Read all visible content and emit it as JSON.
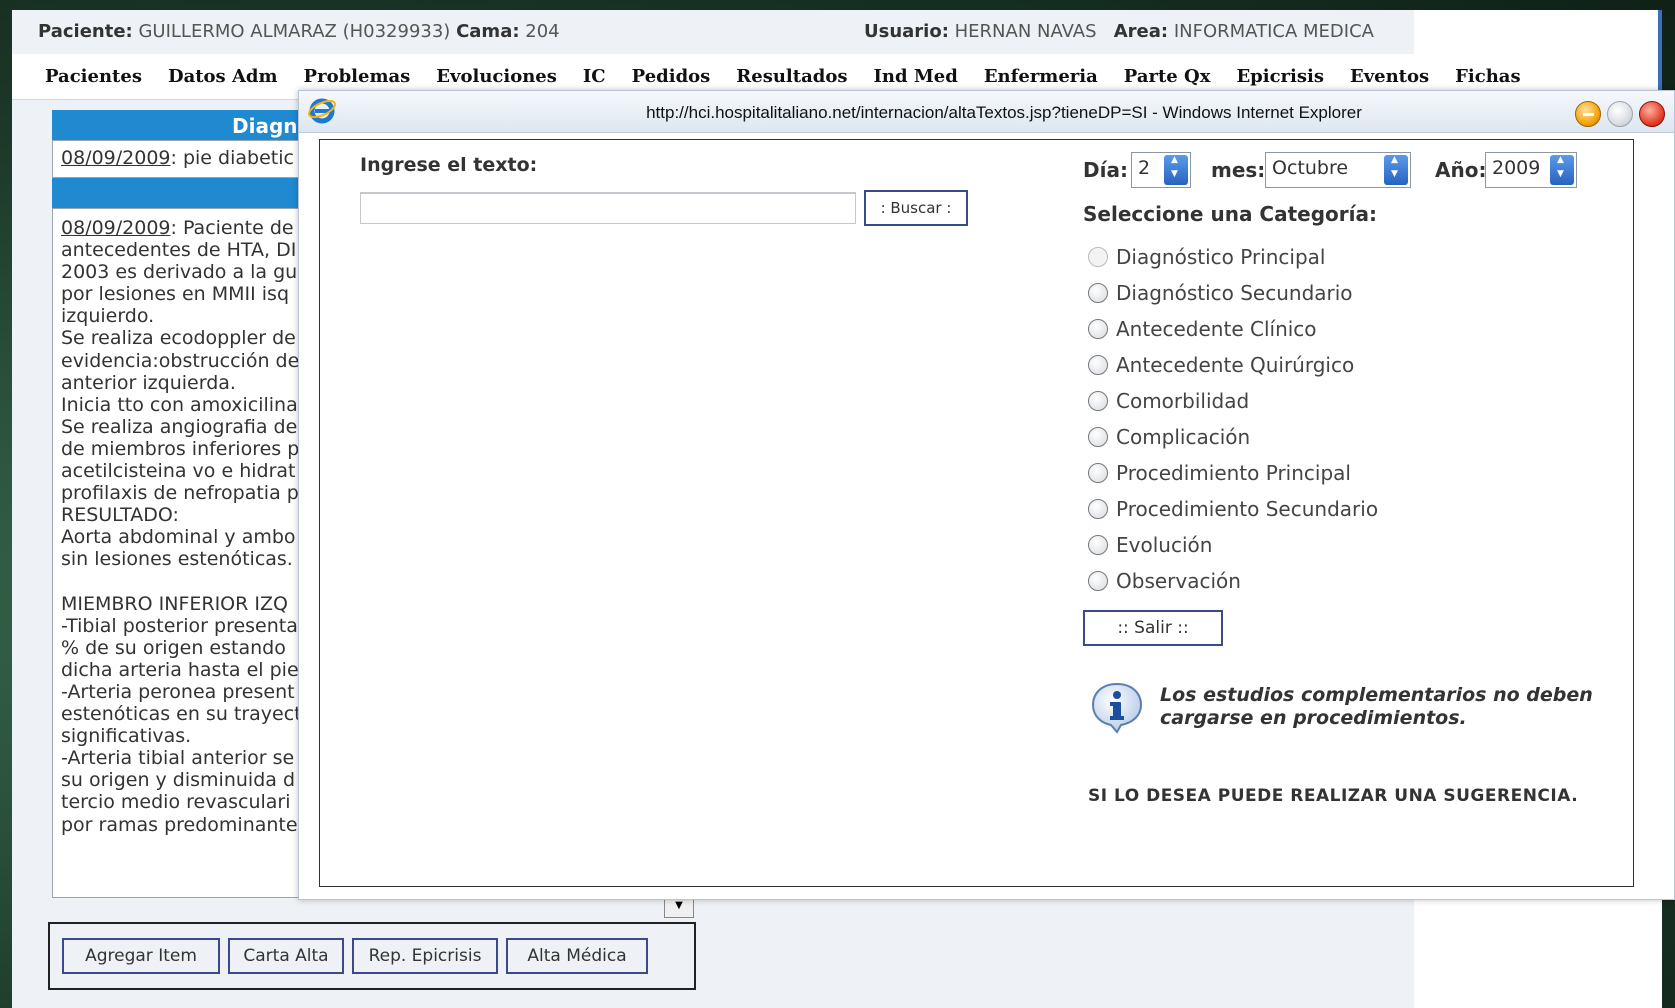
{
  "patient_bar": {
    "paciente_label": "Paciente:",
    "paciente_value": "GUILLERMO ALMARAZ  (H0329933)",
    "cama_label": "Cama:",
    "cama_value": "204",
    "usuario_label": "Usuario:",
    "usuario_value": "HERNAN NAVAS",
    "area_label": "Area:",
    "area_value": "INFORMATICA MEDICA"
  },
  "nav": {
    "items": [
      "Pacientes",
      "Datos Adm",
      "Problemas",
      "Evoluciones",
      "IC",
      "Pedidos",
      "Resultados",
      "Ind Med",
      "Enfermeria",
      "Parte Qx",
      "Epicrisis",
      "Eventos",
      "Fichas"
    ]
  },
  "left_panel": {
    "diag_header": "Diagno",
    "diag_date": "08/09/2009",
    "diag_text": ": pie diabetic",
    "notes_date": "08/09/2009",
    "notes_first": ": Paciente de",
    "notes_lines": [
      "antecedentes de HTA, DI",
      "2003 es derivado a la gu",
      "por lesiones en MMII isq",
      "izquierdo.",
      "Se realiza ecodoppler de",
      "evidencia:obstrucción de",
      "anterior izquierda.",
      "Inicia tto con amoxicilina",
      "Se realiza angiografia de",
      "de miembros inferiores p",
      "acetilcisteina vo e hidrat",
      "profilaxis de nefropatia p",
      "RESULTADO:",
      "Aorta abdominal y ambo",
      "sin lesiones estenóticas.",
      "",
      "MIEMBRO INFERIOR IZQ",
      "-Tibial posterior presenta",
      "% de su origen estando",
      "dicha arteria hasta el pie",
      "-Arteria peronea present",
      "estenóticas en su trayect",
      "significativas.",
      "-Arteria tibial anterior se",
      "su origen y disminuida d",
      "tercio medio revasculari",
      "por ramas predominante"
    ],
    "buttons": [
      "Agregar Item",
      "Carta Alta",
      "Rep. Epicrisis",
      "Alta Médica"
    ]
  },
  "popup": {
    "title": "http://hci.hospitalitaliano.net/internacion/altaTextos.jsp?tieneDP=SI - Windows Internet Explorer",
    "search_label": "Ingrese el texto:",
    "search_value": "",
    "search_button": ": Buscar :",
    "dia_label": "Día:",
    "dia_value": "2",
    "mes_label": "mes:",
    "mes_value": "Octubre",
    "anio_label": "Año:",
    "anio_value": "2009",
    "category_label": "Seleccione una Categoría:",
    "categories": [
      "Diagnóstico Principal",
      "Diagnóstico Secundario",
      "Antecedente Clínico",
      "Antecedente Quirúrgico",
      "Comorbilidad",
      "Complicación",
      "Procedimiento Principal",
      "Procedimiento Secundario",
      "Evolución",
      "Observación"
    ],
    "salir_button": ":: Salir ::",
    "info_text": "Los estudios complementarios no deben cargarse en procedimientos.",
    "sugerencia": "SI LO DESEA PUEDE REALIZAR UNA SUGERENCIA."
  },
  "colors": {
    "header_blue": "#1f8ad0",
    "button_border": "#3b4a8c",
    "frame_green": "#1e3b2c"
  }
}
